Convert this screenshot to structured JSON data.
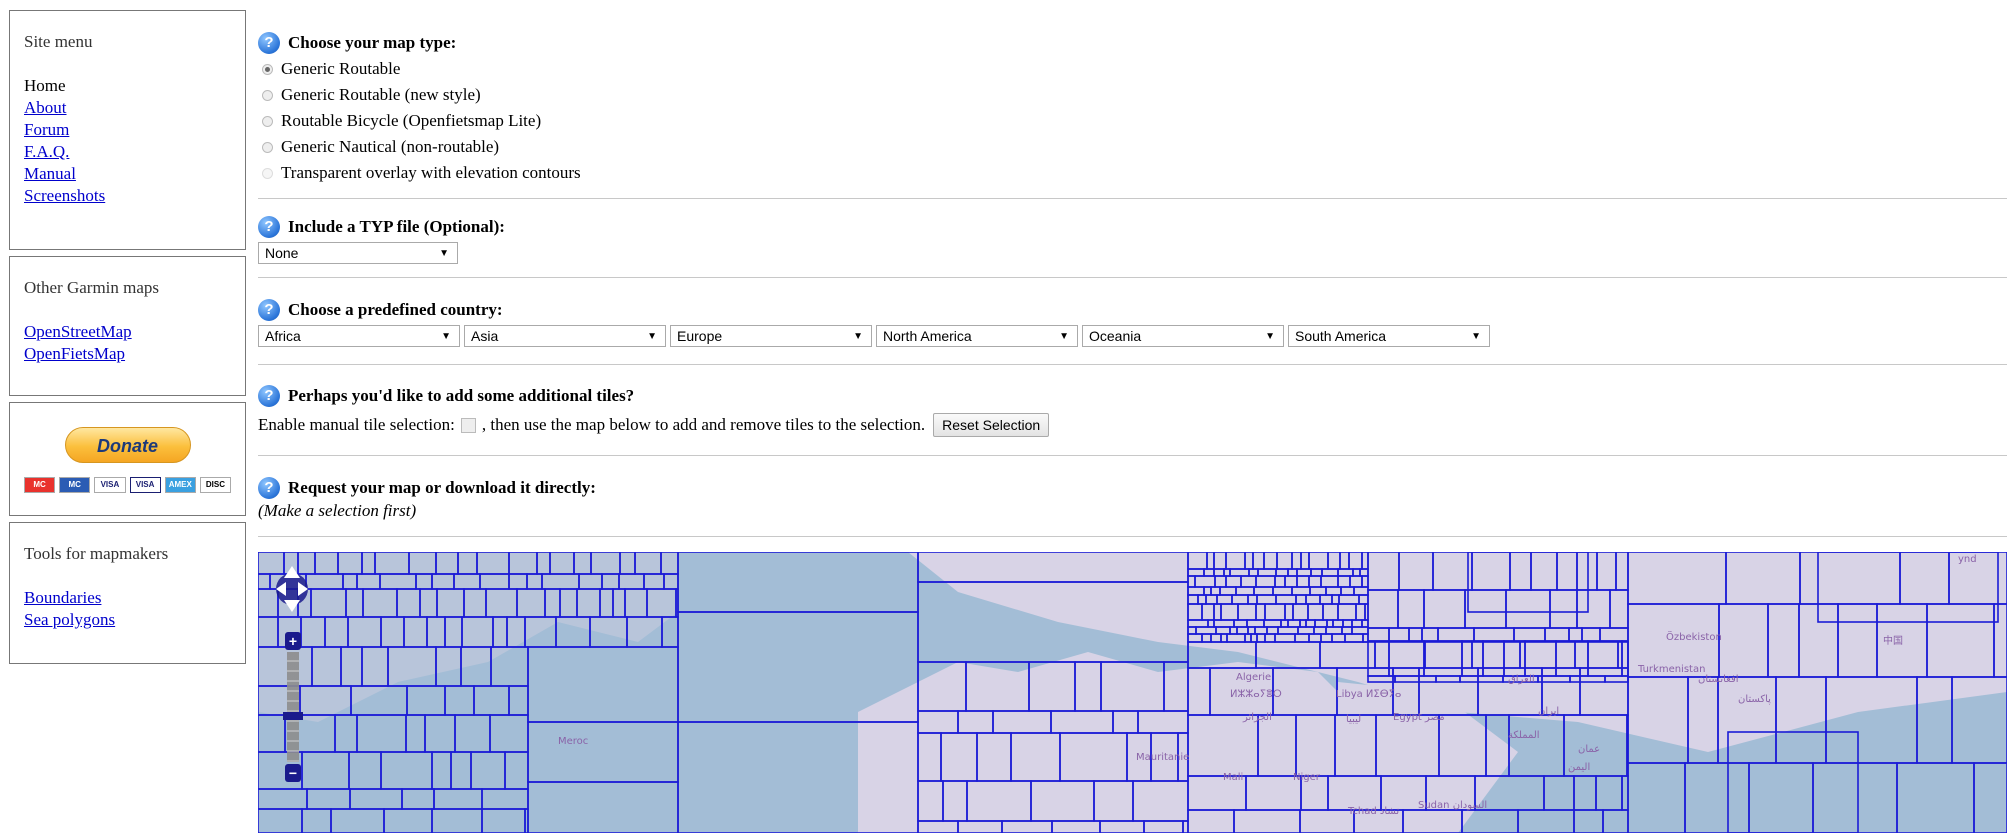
{
  "sidebar": {
    "site_menu": {
      "title": "Site menu",
      "home": "Home",
      "links": [
        "About",
        "Forum",
        "F.A.Q.",
        "Manual",
        "Screenshots"
      ]
    },
    "other_maps": {
      "title": "Other Garmin maps",
      "links": [
        "OpenStreetMap",
        "OpenFietsMap"
      ]
    },
    "donate": {
      "button_label": "Donate",
      "cards": [
        "MC",
        "MC",
        "VISA",
        "VISA",
        "AMEX",
        "DISC"
      ]
    },
    "tools": {
      "title": "Tools for mapmakers",
      "links": [
        "Boundaries",
        "Sea polygons"
      ]
    }
  },
  "map_type": {
    "heading": "Choose your map type:",
    "options": [
      "Generic Routable",
      "Generic Routable (new style)",
      "Routable Bicycle (Openfietsmap Lite)",
      "Generic Nautical (non-routable)",
      "Transparent overlay with elevation contours"
    ],
    "selected": "Generic Routable"
  },
  "typ_file": {
    "heading": "Include a TYP file (Optional):",
    "selected": "None"
  },
  "country": {
    "heading": "Choose a predefined country:",
    "selects": [
      "Africa",
      "Asia",
      "Europe",
      "North America",
      "Oceania",
      "South America"
    ]
  },
  "tiles": {
    "heading": "Perhaps you'd like to add some additional tiles?",
    "text_before": "Enable manual tile selection:",
    "text_after": ", then use the map below to add and remove tiles to the selection.",
    "reset_label": "Reset Selection"
  },
  "request": {
    "heading": "Request your map or download it directly:",
    "note": "(Make a selection first)"
  },
  "map": {
    "labels": [
      "Algerie",
      "ⵍⵣⵣⴰⵢⴻⵔ",
      "الجزائر",
      "Libya ⵍⵉⴱⵢⴰ",
      "ليبيا",
      "Egypt مصر",
      "Mauritanie",
      "Mali",
      "Niger",
      "Tchad تشاد",
      "Sudan السودان",
      "Turkmenistan",
      "Özbekiston",
      "افغانستان",
      "پاکستان",
      "العراق",
      "ایران",
      "المملكة",
      "اليمن",
      "عمان",
      "中国",
      "ynd",
      "Meroc"
    ],
    "colors": {
      "sea": "#a3bdd6",
      "land": "#d8d3e6",
      "grid": "#1b1bd6"
    }
  }
}
